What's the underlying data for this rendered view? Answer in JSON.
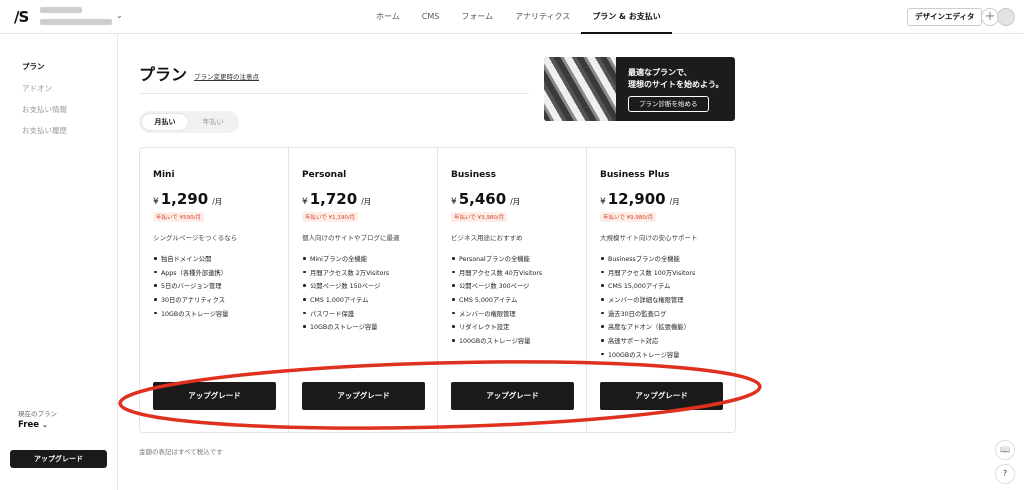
{
  "header": {
    "logo": "/S",
    "nav": [
      "ホーム",
      "CMS",
      "フォーム",
      "アナリティクス",
      "プラン & お支払い"
    ],
    "designer_button": "デザインエディタ",
    "plus_icon": "+"
  },
  "sidebar": {
    "items": [
      "プラン",
      "アドオン",
      "お支払い情報",
      "お支払い履歴"
    ],
    "current_plan_label": "現在のプラン",
    "current_plan_value": "Free",
    "upgrade_button": "アップグレード"
  },
  "main": {
    "title": "プラン",
    "title_link": "プラン変更時の注意点",
    "banner": {
      "line1": "最適なプランで、",
      "line2": "理想のサイトを始めよう。",
      "button": "プラン診断を始める"
    },
    "toggle": {
      "monthly": "月払い",
      "yearly": "年払い"
    },
    "plans": [
      {
        "name": "Mini",
        "currency": "¥",
        "price": "1,290",
        "unit": "/月",
        "annual": "年払いで ¥590/月",
        "desc": "シングルページをつくるなら",
        "features": [
          "独自ドメイン公開",
          "Apps（各種外部連携）",
          "5日のバージョン管理",
          "30日のアナリティクス",
          "10GBのストレージ容量"
        ],
        "button": "アップグレード"
      },
      {
        "name": "Personal",
        "currency": "¥",
        "price": "1,720",
        "unit": "/月",
        "annual": "年払いで ¥1,190/月",
        "desc": "個人向けのサイトやブログに最適",
        "features": [
          "Miniプランの全機能",
          "月間アクセス数 2万Visitors",
          "公開ページ数 150ページ",
          "CMS 1,000アイテム",
          "パスワード保護",
          "10GBのストレージ容量"
        ],
        "button": "アップグレード"
      },
      {
        "name": "Business",
        "currency": "¥",
        "price": "5,460",
        "unit": "/月",
        "annual": "年払いで ¥3,980/月",
        "desc": "ビジネス用途におすすめ",
        "features": [
          "Personalプランの全機能",
          "月間アクセス数 40万Visitors",
          "公開ページ数 300ページ",
          "CMS 5,000アイテム",
          "メンバーの権限管理",
          "リダイレクト設定",
          "100GBのストレージ容量"
        ],
        "button": "アップグレード"
      },
      {
        "name": "Business Plus",
        "currency": "¥",
        "price": "12,900",
        "unit": "/月",
        "annual": "年払いで ¥9,980/月",
        "desc": "大規模サイト向けの安心サポート",
        "features": [
          "Businessプランの全機能",
          "月間アクセス数 100万Visitors",
          "CMS 15,000アイテム",
          "メンバーの詳細な権限管理",
          "過去30日の監査ログ",
          "高度なアドオン（拡張機能）",
          "高速サポート対応",
          "100GBのストレージ容量"
        ],
        "button": "アップグレード"
      }
    ],
    "footnote": "金額の表記はすべて税込です"
  },
  "floating": {
    "book_icon": "📖",
    "help": "?"
  },
  "colors": {
    "accent": "#1a1a1a",
    "annotation": "#e0301e",
    "annual_badge": "#d9401c"
  }
}
